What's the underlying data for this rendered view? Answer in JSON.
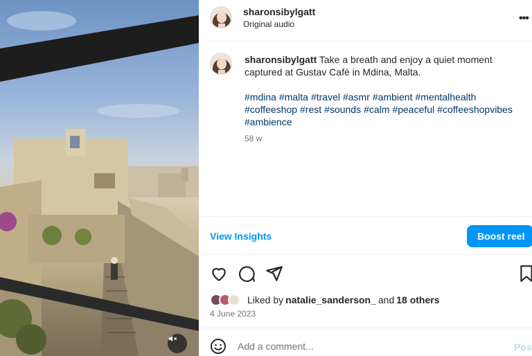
{
  "post": {
    "username": "sharonsibylgatt",
    "audio": "Original audio",
    "caption_text": "Take a breath and enjoy a quiet moment captured at Gustav Café in Mdina, Malta.",
    "hashtags": [
      "#mdina",
      "#malta",
      "#travel",
      "#asmr",
      "#ambient",
      "#mentalhealth",
      "#coffeeshop",
      "#rest",
      "#sounds",
      "#calm",
      "#peaceful",
      "#coffeeshopvibes",
      "#ambience"
    ],
    "caption_age": "58 w",
    "more_icon": "more-horizontal-icon"
  },
  "insights": {
    "view_label": "View Insights",
    "boost_label": "Boost reel"
  },
  "actions": {
    "icons": [
      "heart-icon",
      "comment-icon",
      "share-icon",
      "bookmark-icon"
    ]
  },
  "likes": {
    "prefix": "Liked by",
    "user": "natalie_sanderson_",
    "connector": "and",
    "others": "18 others"
  },
  "date": "4 June 2023",
  "comment": {
    "placeholder": "Add a comment...",
    "post_label": "Post",
    "emoji_icon": "emoji-icon"
  },
  "media": {
    "mute_icon": "speaker-muted-icon"
  },
  "colors": {
    "accent": "#0095f6",
    "hashtag": "#00376b",
    "post_disabled": "#b2dffc"
  }
}
